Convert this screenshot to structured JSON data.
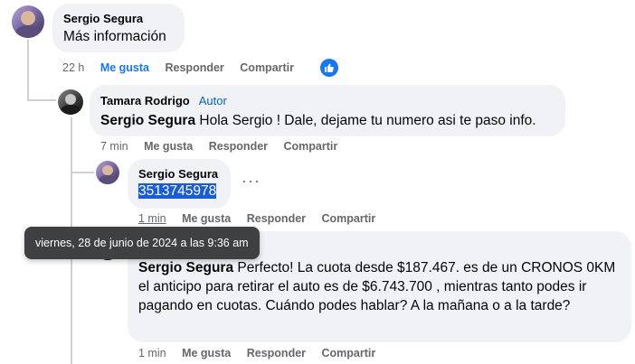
{
  "comments": [
    {
      "author": "Sergio Segura",
      "text": "Más información",
      "time": "22 h",
      "like_label": "Me gusta",
      "reply_label": "Responder",
      "share_label": "Compartir"
    },
    {
      "author": "Tamara Rodrigo",
      "badge": "Autor",
      "mention": "Sergio Segura",
      "text": " Hola Sergio ! Dale, dejame tu numero asi te paso info.",
      "time": "7 min",
      "like_label": "Me gusta",
      "reply_label": "Responder",
      "share_label": "Compartir"
    },
    {
      "author": "Sergio Segura",
      "text": "3513745978",
      "time": "1 min",
      "like_label": "Me gusta",
      "reply_label": "Responder",
      "share_label": "Compartir",
      "more": "···"
    },
    {
      "mention": "Sergio Segura",
      "text": " Perfecto! La cuota desde $187.467. es de un CRONOS 0KM el anticipo para retirar el auto es de $6.743.700 , mientras tanto podes ir pagando en cuotas. Cuándo podes hablar? A la mañana o a la tarde?",
      "time": "1 min",
      "like_label": "Me gusta",
      "reply_label": "Responder",
      "share_label": "Compartir"
    }
  ],
  "tooltip": "viernes, 28 de junio de 2024 a las 9:36 am",
  "colors": {
    "bubble": "#f0f2f5",
    "accent": "#1877f2",
    "tooltip_bg": "#3e4042",
    "selection": "#1a5bd6"
  }
}
